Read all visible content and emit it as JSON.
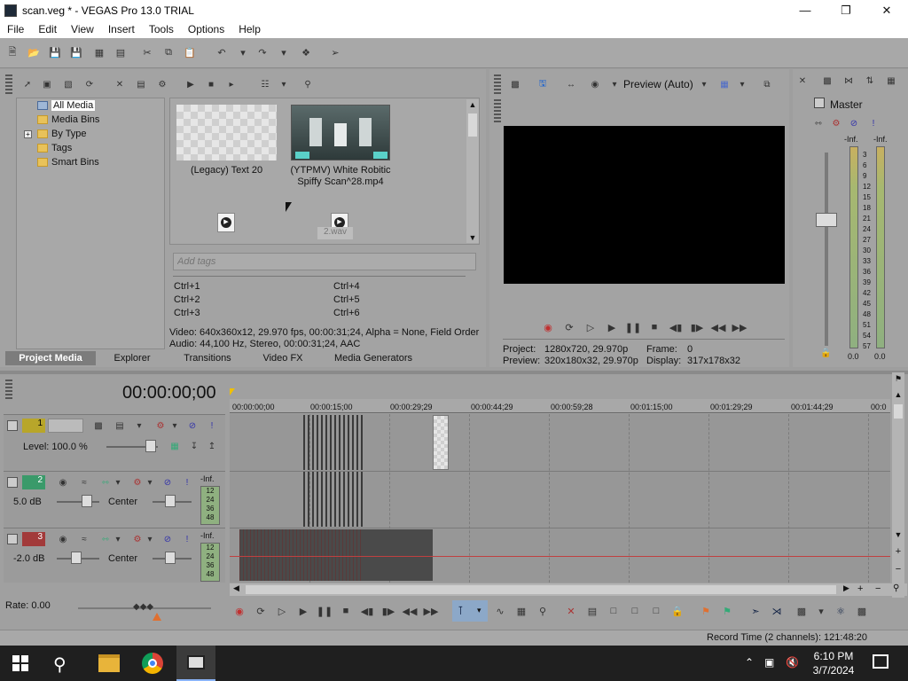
{
  "window": {
    "title": "scan.veg * - VEGAS Pro 13.0 TRIAL"
  },
  "menu": [
    "File",
    "Edit",
    "View",
    "Insert",
    "Tools",
    "Options",
    "Help"
  ],
  "media_tree": [
    "All Media",
    "Media Bins",
    "By Type",
    "Tags",
    "Smart Bins"
  ],
  "media_items": {
    "item1": "(Legacy) Text 20",
    "item2_line1": "(YTPMV) White Robitic",
    "item2_line2": "Spiffy Scan^28.mp4",
    "item4_label": "2.wav"
  },
  "tags_placeholder": "Add tags",
  "shortcuts": [
    "Ctrl+1",
    "Ctrl+2",
    "Ctrl+3",
    "Ctrl+4",
    "Ctrl+5",
    "Ctrl+6"
  ],
  "media_info": {
    "video": "Video: 640x360x12, 29.970 fps, 00:00:31;24, Alpha = None, Field Order",
    "audio": "Audio: 44,100 Hz, Stereo, 00:00:31;24, AAC"
  },
  "bottom_tabs": [
    "Project Media",
    "Explorer",
    "Transitions",
    "Video FX",
    "Media Generators"
  ],
  "preview": {
    "mode": "Preview (Auto)",
    "project_label": "Project:",
    "project_value": "1280x720, 29.970p",
    "preview_label": "Preview:",
    "preview_value": "320x180x32, 29.970p",
    "frame_label": "Frame:",
    "frame_value": "0",
    "display_label": "Display:",
    "display_value": "317x178x32"
  },
  "master": {
    "title": "Master",
    "inf_left": "-Inf.",
    "inf_right": "-Inf.",
    "scale": [
      "3",
      "6",
      "9",
      "12",
      "15",
      "18",
      "21",
      "24",
      "27",
      "30",
      "33",
      "36",
      "39",
      "42",
      "45",
      "48",
      "51",
      "54",
      "57"
    ],
    "bottom_left": "0.0",
    "bottom_right": "0.0"
  },
  "timeline": {
    "timecode": "00:00:00;00",
    "ruler": [
      "00:00:00;00",
      "00:00:15;00",
      "00:00:29;29",
      "00:00:44;29",
      "00:00:59;28",
      "00:01:15;00",
      "00:01:29;29",
      "00:01:44;29",
      "00:0"
    ],
    "tracks": [
      {
        "num": "1",
        "info": "Level: 100.0 %",
        "color": "#b8a62a"
      },
      {
        "num": "2",
        "info": "5.0 dB",
        "pan": "Center",
        "inf": "-Inf.",
        "color": "#3a9a6a"
      },
      {
        "num": "3",
        "info": "-2.0 dB",
        "pan": "Center",
        "inf": "-Inf.",
        "color": "#a23a3a"
      }
    ],
    "meter_scale": [
      "12",
      "24",
      "36",
      "48"
    ],
    "rate": "Rate: 0.00",
    "record_time": "Record Time (2 channels): 121:48:20"
  },
  "taskbar": {
    "time": "6:10 PM",
    "date": "3/7/2024"
  }
}
